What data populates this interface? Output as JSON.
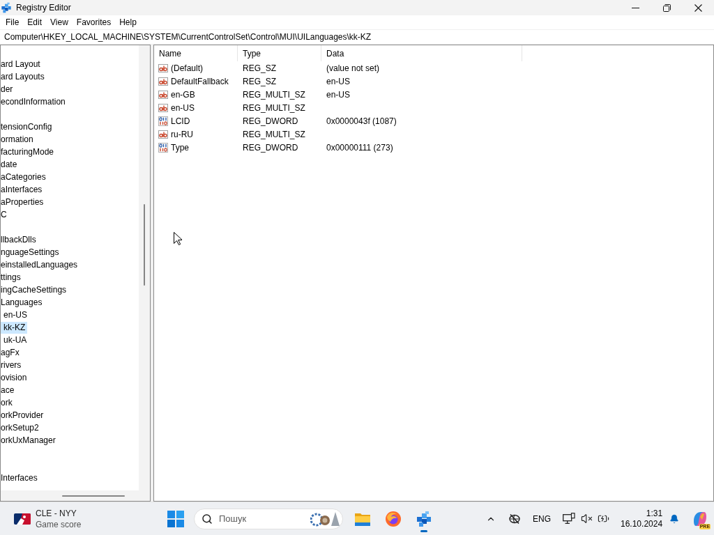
{
  "window": {
    "title": "Registry Editor"
  },
  "menu": [
    "File",
    "Edit",
    "View",
    "Favorites",
    "Help"
  ],
  "address_bar": {
    "value": "Computer\\HKEY_LOCAL_MACHINE\\SYSTEM\\CurrentControlSet\\Control\\MUI\\UILanguages\\kk-KZ"
  },
  "tree": {
    "items": [
      {
        "label": "ard Layout",
        "selected": false
      },
      {
        "label": "ard Layouts",
        "selected": false
      },
      {
        "label": "der",
        "selected": false
      },
      {
        "label": "econdInformation",
        "selected": false
      },
      {
        "label": "tensionConfig",
        "selected": false
      },
      {
        "label": "ormation",
        "selected": false
      },
      {
        "label": "facturingMode",
        "selected": false
      },
      {
        "label": "date",
        "selected": false
      },
      {
        "label": "aCategories",
        "selected": false
      },
      {
        "label": "aInterfaces",
        "selected": false
      },
      {
        "label": "aProperties",
        "selected": false
      },
      {
        "label": "C",
        "selected": false
      },
      {
        "label": "llbackDlls",
        "selected": false
      },
      {
        "label": "nguageSettings",
        "selected": false
      },
      {
        "label": "einstalledLanguages",
        "selected": false
      },
      {
        "label": "ttings",
        "selected": false
      },
      {
        "label": "ingCacheSettings",
        "selected": false
      },
      {
        "label": "Languages",
        "selected": false,
        "children": [
          {
            "label": "en-US",
            "selected": false
          },
          {
            "label": "kk-KZ",
            "selected": true
          },
          {
            "label": "uk-UA",
            "selected": false
          }
        ]
      },
      {
        "label": "agFx",
        "selected": false
      },
      {
        "label": "rivers",
        "selected": false
      },
      {
        "label": "ovision",
        "selected": false
      },
      {
        "label": "ace",
        "selected": false
      },
      {
        "label": "ork",
        "selected": false
      },
      {
        "label": "orkProvider",
        "selected": false
      },
      {
        "label": "orkSetup2",
        "selected": false
      },
      {
        "label": "orkUxManager",
        "selected": false
      },
      {
        "label": "Interfaces",
        "selected": false
      }
    ]
  },
  "values": {
    "columns": [
      "Name",
      "Type",
      "Data"
    ],
    "rows": [
      {
        "kind": "string",
        "name": "(Default)",
        "type": "REG_SZ",
        "data": "(value not set)",
        "selected": false
      },
      {
        "kind": "string",
        "name": "DefaultFallback",
        "type": "REG_SZ",
        "data": "en-US",
        "selected": false
      },
      {
        "kind": "string",
        "name": "en-GB",
        "type": "REG_MULTI_SZ",
        "data": "en-US",
        "selected": false
      },
      {
        "kind": "string",
        "name": "en-US",
        "type": "REG_MULTI_SZ",
        "selected": false
      },
      {
        "kind": "binary",
        "name": "LCID",
        "type": "REG_DWORD",
        "data": "0x0000043f (1087)",
        "selected": false
      },
      {
        "kind": "string",
        "name": "ru-RU",
        "type": "REG_MULTI_SZ",
        "selected": false
      },
      {
        "kind": "binary",
        "name": "Type",
        "type": "REG_DWORD",
        "data": "0x00000111 (273)",
        "selected": false
      }
    ]
  },
  "taskbar": {
    "widget": {
      "title": "CLE - NYY",
      "subtitle": "Game score"
    },
    "search": {
      "placeholder": "Пошук"
    },
    "apps": [
      {
        "kind": "explorer",
        "active": false
      },
      {
        "kind": "firefox",
        "active": false
      },
      {
        "kind": "regedit",
        "active": true
      }
    ],
    "tray": {
      "language": "ENG",
      "time": "1:31",
      "date": "16.10.2024",
      "copilot_badge": "PRE"
    }
  }
}
